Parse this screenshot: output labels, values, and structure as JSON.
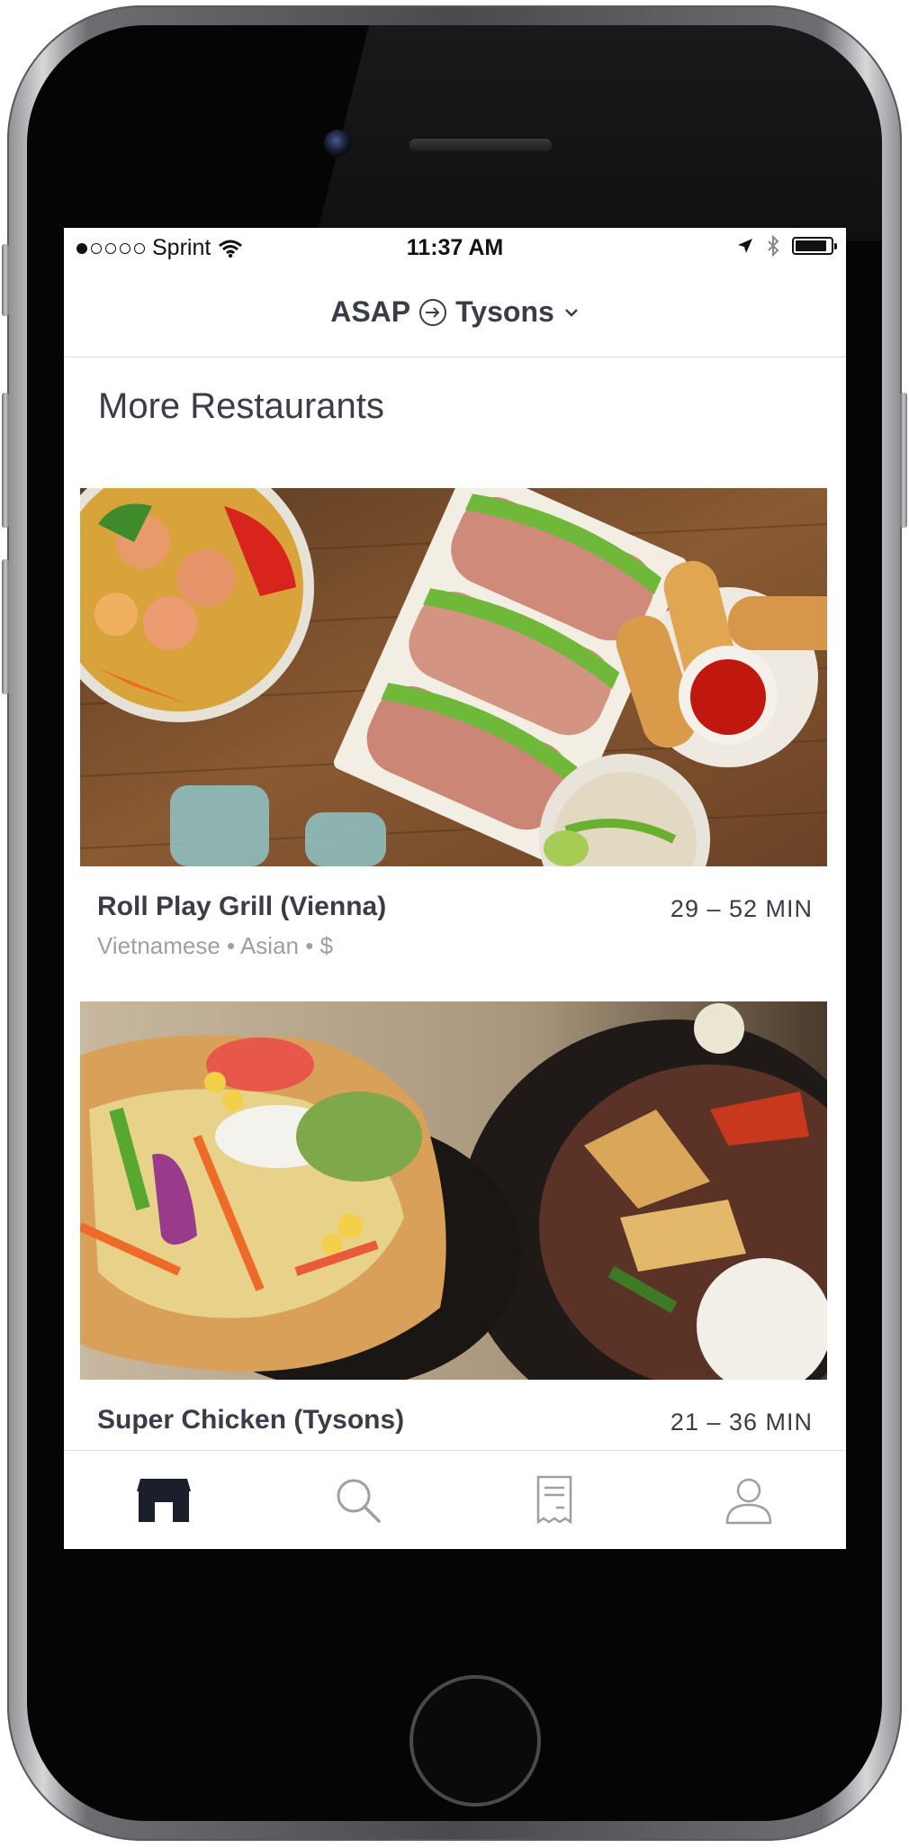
{
  "status_bar": {
    "carrier": "Sprint",
    "time": "11:37 AM",
    "battery_level": 0.9
  },
  "location_bar": {
    "when": "ASAP",
    "place": "Tysons"
  },
  "section": {
    "title": "More Restaurants"
  },
  "restaurants": [
    {
      "name": "Roll Play Grill (Vienna)",
      "eta": "29 – 52 MIN",
      "meta": "Vietnamese • Asian • $"
    },
    {
      "name": "Super Chicken (Tysons)",
      "eta": "21 – 36 MIN",
      "meta": ""
    }
  ],
  "tabs": [
    {
      "icon": "store-icon",
      "active": true
    },
    {
      "icon": "search-icon",
      "active": false
    },
    {
      "icon": "receipt-icon",
      "active": false
    },
    {
      "icon": "account-icon",
      "active": false
    }
  ],
  "colors": {
    "text_primary": "#3a3d47",
    "text_secondary": "#9d9fa6",
    "tab_active": "#1b1e2b",
    "tab_inactive": "#9d9fa6"
  }
}
